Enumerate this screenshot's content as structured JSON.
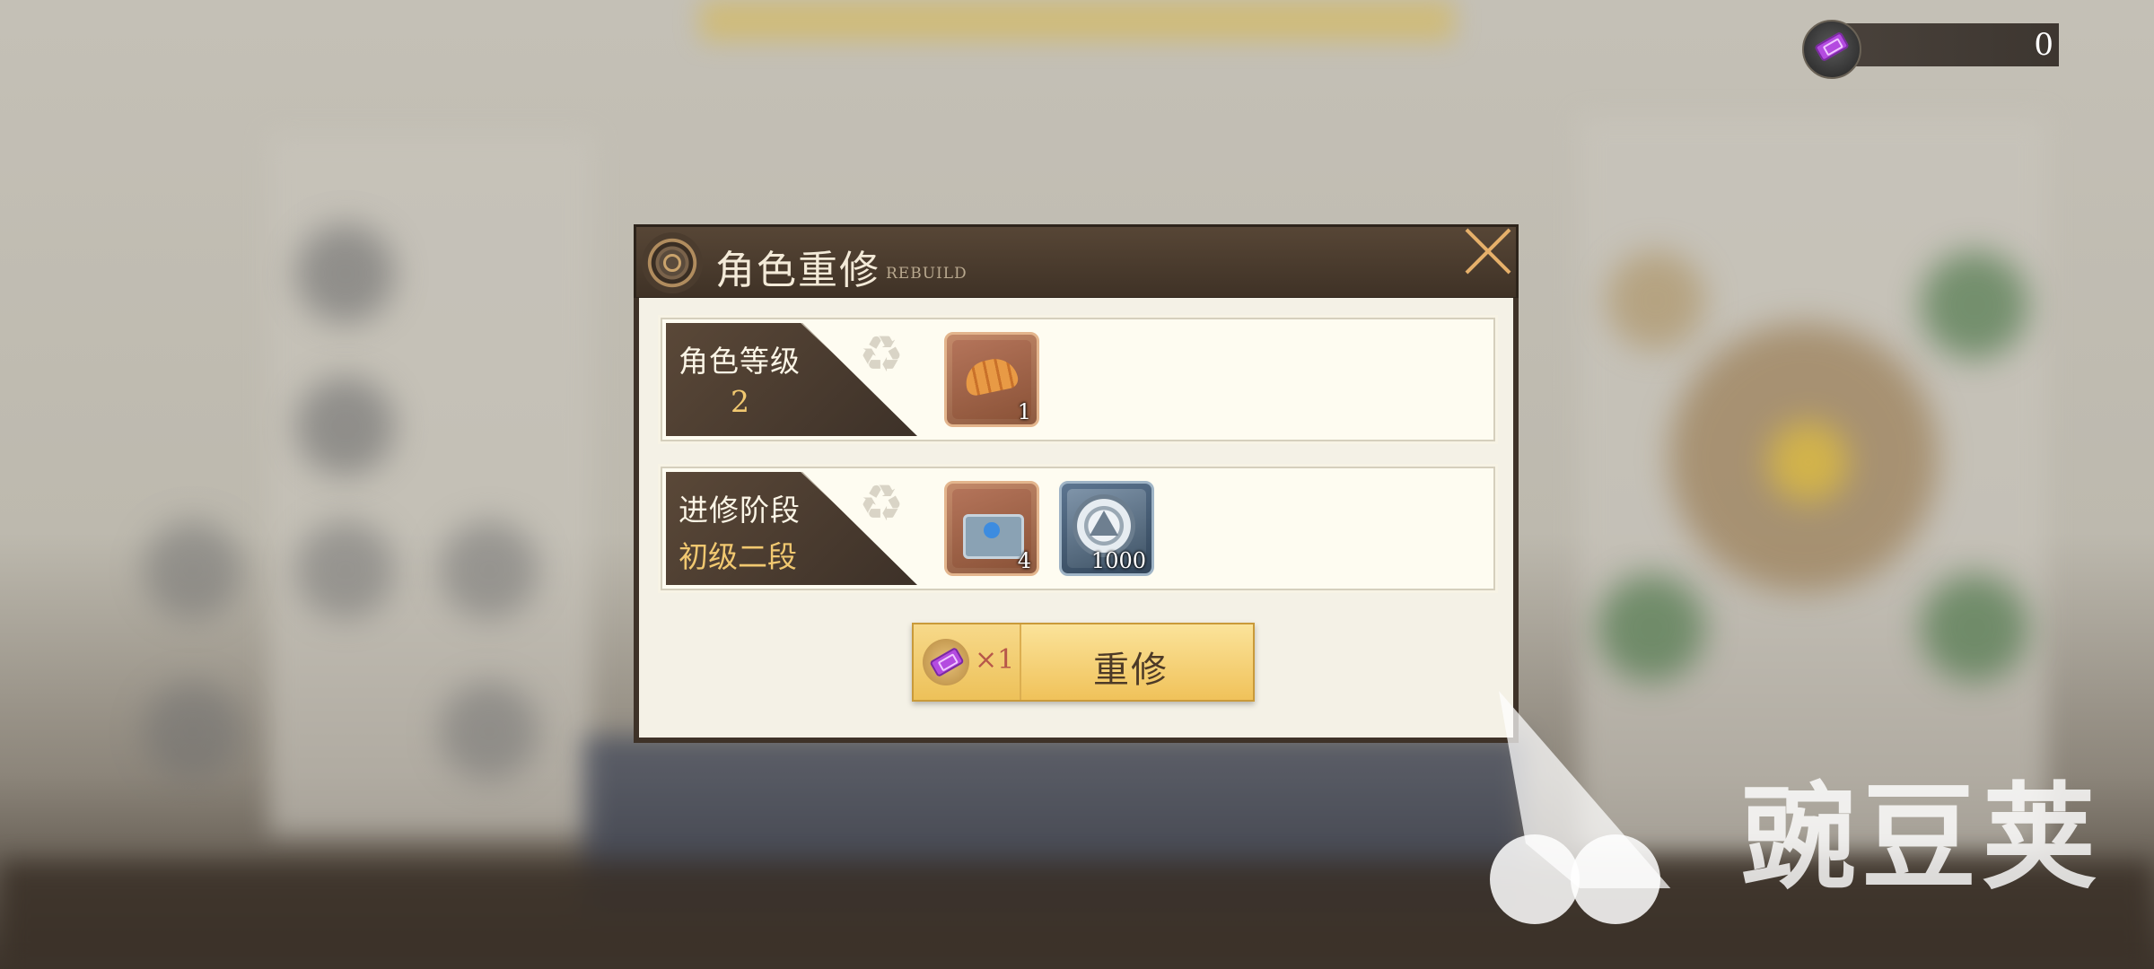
{
  "currency": {
    "icon": "purple-ticket-icon",
    "value": "0"
  },
  "dialog": {
    "title": "角色重修",
    "subtitle": "REBUILD",
    "rows": [
      {
        "name": "角色等级",
        "value": "2",
        "items": [
          {
            "icon": "croissant-icon",
            "qty": "1"
          }
        ]
      },
      {
        "name": "进修阶段",
        "value": "初级二段",
        "items": [
          {
            "icon": "treasure-chest-icon",
            "qty": "4"
          },
          {
            "icon": "silver-coin-icon",
            "qty": "1000"
          }
        ]
      }
    ],
    "button": {
      "cost_prefix": "×1",
      "label": "重修"
    }
  },
  "watermark": {
    "text": "豌豆荚"
  },
  "colors": {
    "header": "#4a3b2e",
    "accent": "#f1c870",
    "button": "#f5d27a",
    "close": "#e6b06a"
  }
}
